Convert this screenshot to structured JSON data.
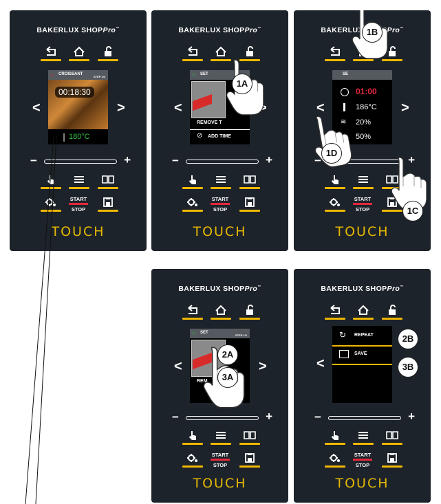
{
  "brand": "BAKERLUX SHOP",
  "brand_suffix": "Pro",
  "brand_tm": "™",
  "start": "START",
  "stop": "STOP",
  "touch": "TOUCH",
  "panel1": {
    "program": "CROISSANT",
    "step": "STEP 1/2",
    "time": "00:18:30",
    "temp": "180°C"
  },
  "panel2": {
    "header": "SET",
    "step": "STEP 1/2",
    "remove": "REMOVE T",
    "add_time": "ADD TIME",
    "callout": "1A"
  },
  "panel3": {
    "header": "SE",
    "time": "01:00",
    "temp": "186°C",
    "humidity": "20%",
    "fan": "50%",
    "callouts": [
      "1B",
      "1D",
      "1C"
    ]
  },
  "panel4": {
    "header": "SET",
    "step": "STEP 1/2",
    "remove": "REM",
    "callouts": [
      "2A",
      "3A"
    ]
  },
  "panel5": {
    "repeat": "REPEAT",
    "save": "SAVE",
    "callouts": [
      "2B",
      "3B"
    ]
  },
  "colors": {
    "panel": "#1d232a",
    "accent": "#f0b800",
    "start_bar": "#e5283c",
    "temp_green": "#32c04a",
    "time_red": "#e5283c"
  },
  "icons": [
    "back-icon",
    "home-icon",
    "unlock-icon",
    "manual-hand-icon",
    "menu-icon",
    "book-icon",
    "settings-icon",
    "save-icon",
    "clock-icon",
    "thermometer-icon",
    "steam-icon",
    "fan-icon",
    "repeat-icon"
  ]
}
